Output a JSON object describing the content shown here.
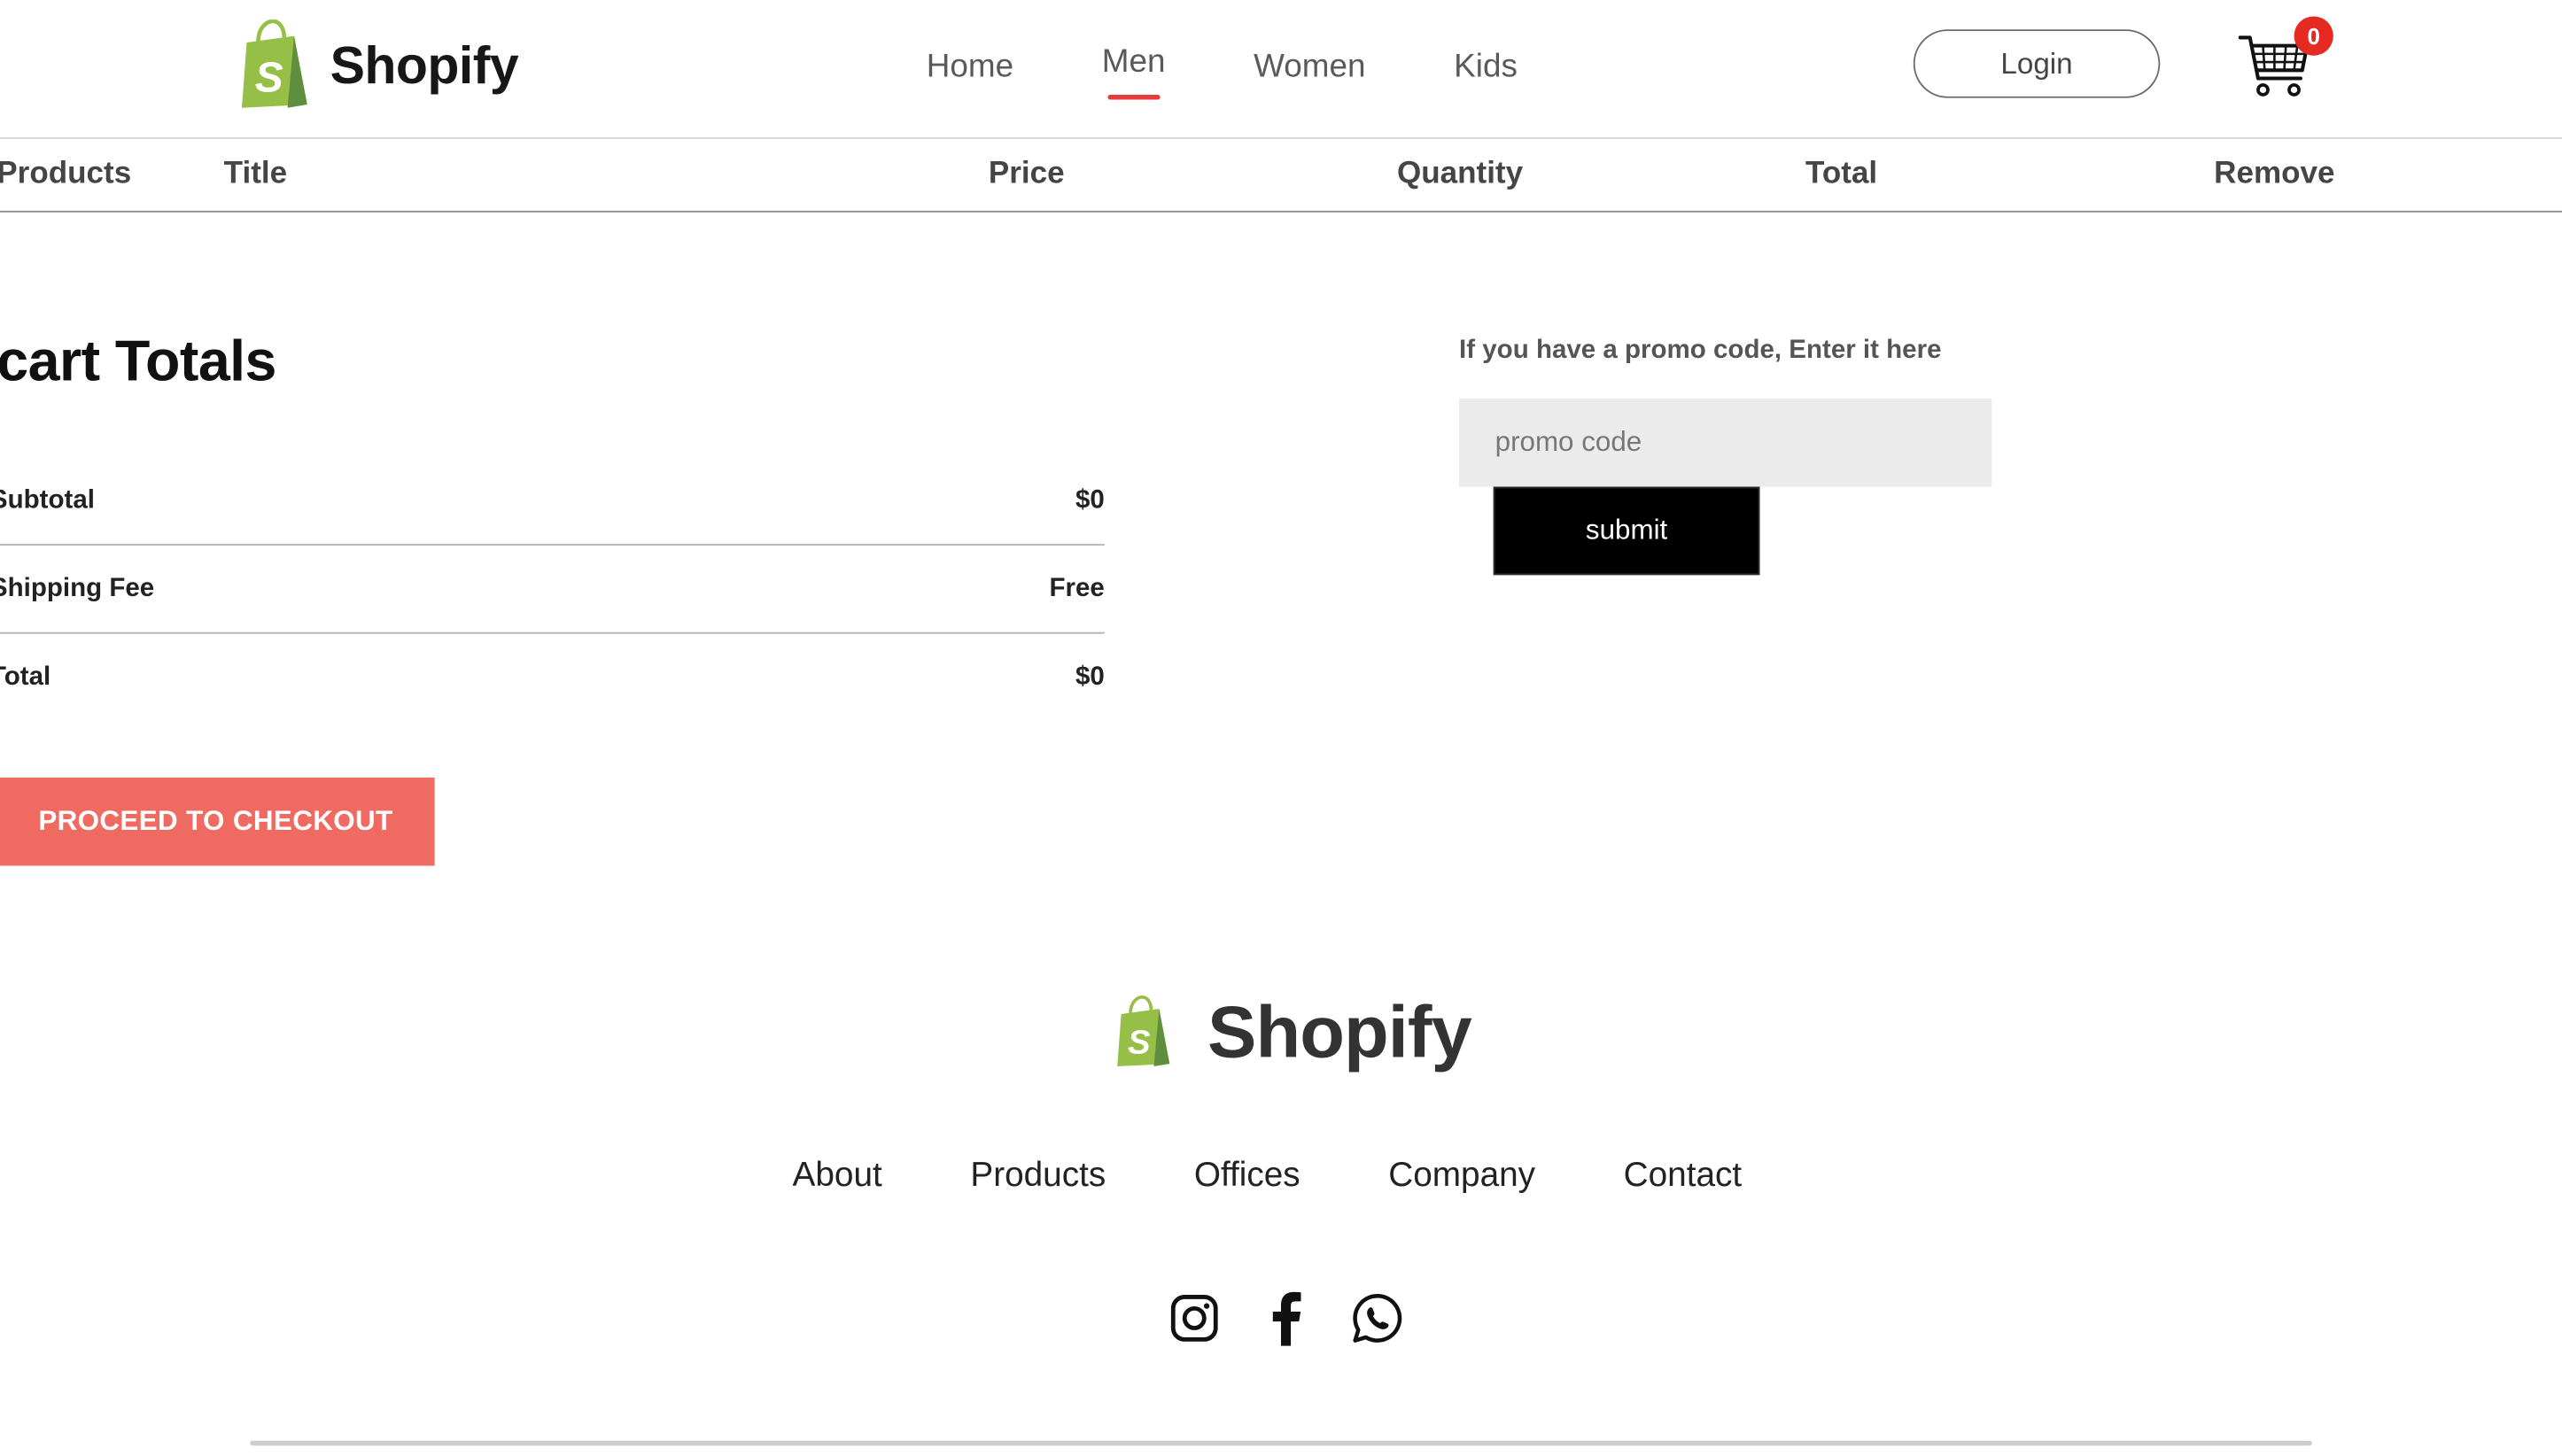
{
  "brand": {
    "name": "Shopify"
  },
  "nav": {
    "items": [
      {
        "label": "Home"
      },
      {
        "label": "Men"
      },
      {
        "label": "Women"
      },
      {
        "label": "Kids"
      }
    ],
    "active": "Men",
    "login_label": "Login",
    "cart_count": "0"
  },
  "cart_table": {
    "columns": [
      "Products",
      "Title",
      "Price",
      "Quantity",
      "Total",
      "Remove"
    ]
  },
  "totals": {
    "title": "cart Totals",
    "rows": [
      {
        "label": "Subtotal",
        "value": "$0"
      },
      {
        "label": "Shipping Fee",
        "value": "Free"
      },
      {
        "label": "Total",
        "value": "$0"
      }
    ],
    "checkout_label": "PROCEED TO CHECKOUT"
  },
  "promo": {
    "label": "If you have a promo code, Enter it here",
    "placeholder": "promo code",
    "value": "",
    "submit_label": "submit"
  },
  "footer": {
    "brand": "Shopify",
    "links": [
      "About",
      "Products",
      "Offices",
      "Company",
      "Contact"
    ],
    "socials": [
      "instagram-icon",
      "facebook-icon",
      "whatsapp-icon"
    ]
  },
  "colors": {
    "accent_red": "#e63b3b",
    "checkout_bg": "#ef6b62",
    "shopify_green": "#95bf47",
    "badge_red": "#e52a22"
  }
}
